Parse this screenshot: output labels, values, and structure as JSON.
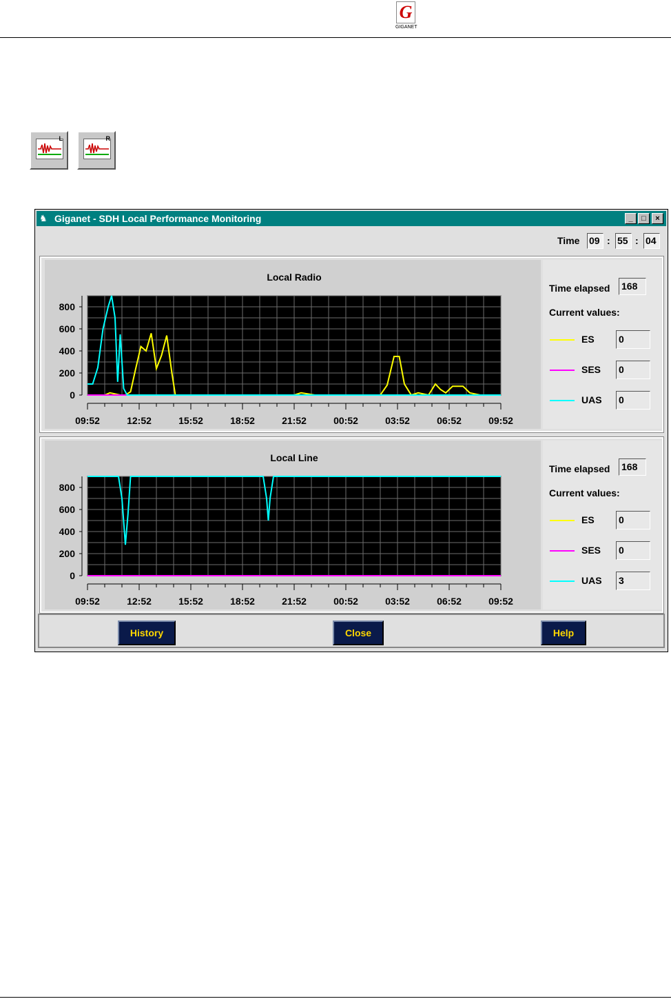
{
  "header": {
    "logo_text": "GIGANET",
    "logo_mark": "G"
  },
  "toolbar": {
    "buttons": [
      {
        "name": "local-performance-button",
        "badge": "L",
        "icon": "waveform-icon"
      },
      {
        "name": "remote-performance-button",
        "badge": "R",
        "icon": "waveform-icon"
      }
    ]
  },
  "window": {
    "title": "Giganet - SDH Local Performance Monitoring",
    "controls": {
      "minimize": "_",
      "maximize": "□",
      "close": "×"
    },
    "time": {
      "label": "Time",
      "hours": "09",
      "minutes": "55",
      "seconds": "04",
      "sep": ":"
    }
  },
  "panels": [
    {
      "id": "radio",
      "time_elapsed_label": "Time elapsed",
      "time_elapsed_value": "168",
      "current_values_label": "Current values:",
      "legend": [
        {
          "label": "ES",
          "value": "0",
          "color": "#ffff00"
        },
        {
          "label": "SES",
          "value": "0",
          "color": "#ff00ff"
        },
        {
          "label": "UAS",
          "value": "0",
          "color": "#00ffff"
        }
      ]
    },
    {
      "id": "line",
      "time_elapsed_label": "Time elapsed",
      "time_elapsed_value": "168",
      "current_values_label": "Current values:",
      "legend": [
        {
          "label": "ES",
          "value": "0",
          "color": "#ffff00"
        },
        {
          "label": "SES",
          "value": "0",
          "color": "#ff00ff"
        },
        {
          "label": "UAS",
          "value": "3",
          "color": "#00ffff"
        }
      ]
    }
  ],
  "buttons": {
    "history": "History",
    "close": "Close",
    "help": "Help"
  },
  "chart_data": [
    {
      "type": "line",
      "title": "Local Radio",
      "x_tick_labels": [
        "09:52",
        "12:52",
        "15:52",
        "18:52",
        "21:52",
        "00:52",
        "03:52",
        "06:52",
        "09:52"
      ],
      "xlim": [
        0,
        24
      ],
      "ylim": [
        0,
        900
      ],
      "y_ticks": [
        0,
        200,
        400,
        600,
        800
      ],
      "grid": true,
      "background": "#000000",
      "series": [
        {
          "name": "ES",
          "color": "#ffff00",
          "x": [
            0,
            0.5,
            1,
            1.3,
            1.6,
            1.9,
            2.2,
            2.5,
            2.8,
            3.1,
            3.4,
            3.7,
            4.0,
            4.3,
            4.6,
            4.9,
            5.1,
            5.4,
            6,
            8,
            10,
            12,
            12.4,
            12.8,
            13.2,
            16,
            17,
            17.4,
            17.8,
            18.1,
            18.4,
            18.8,
            19.2,
            19.8,
            20.2,
            20.5,
            20.8,
            21.2,
            21.8,
            22.2,
            22.8,
            24
          ],
          "y": [
            0,
            0,
            0,
            20,
            10,
            0,
            0,
            30,
            240,
            440,
            400,
            560,
            240,
            360,
            540,
            200,
            0,
            0,
            0,
            0,
            0,
            0,
            20,
            10,
            0,
            0,
            0,
            90,
            350,
            350,
            100,
            0,
            20,
            0,
            100,
            50,
            20,
            80,
            80,
            20,
            0,
            0
          ]
        },
        {
          "name": "SES",
          "color": "#ff00ff",
          "x": [
            0,
            24
          ],
          "y": [
            0,
            0
          ]
        },
        {
          "name": "UAS",
          "color": "#00ffff",
          "x": [
            0,
            0.3,
            0.6,
            0.9,
            1.2,
            1.4,
            1.6,
            1.75,
            1.9,
            2.1,
            2.3,
            2.6,
            24
          ],
          "y": [
            100,
            100,
            250,
            600,
            800,
            900,
            700,
            120,
            550,
            60,
            0,
            0,
            0
          ]
        }
      ]
    },
    {
      "type": "line",
      "title": "Local Line",
      "x_tick_labels": [
        "09:52",
        "12:52",
        "15:52",
        "18:52",
        "21:52",
        "00:52",
        "03:52",
        "06:52",
        "09:52"
      ],
      "xlim": [
        0,
        24
      ],
      "ylim": [
        0,
        900
      ],
      "y_ticks": [
        0,
        200,
        400,
        600,
        800
      ],
      "grid": true,
      "background": "#000000",
      "series": [
        {
          "name": "ES",
          "color": "#ffff00",
          "x": [
            0,
            24
          ],
          "y": [
            0,
            0
          ]
        },
        {
          "name": "SES",
          "color": "#ff00ff",
          "x": [
            0,
            24
          ],
          "y": [
            0,
            0
          ]
        },
        {
          "name": "UAS",
          "color": "#00ffff",
          "x": [
            0,
            1.8,
            2.0,
            2.2,
            2.35,
            2.5,
            2.7,
            10.2,
            10.4,
            10.5,
            10.6,
            10.8,
            24
          ],
          "y": [
            900,
            900,
            700,
            280,
            560,
            900,
            900,
            900,
            700,
            500,
            700,
            900,
            900
          ]
        }
      ]
    }
  ]
}
